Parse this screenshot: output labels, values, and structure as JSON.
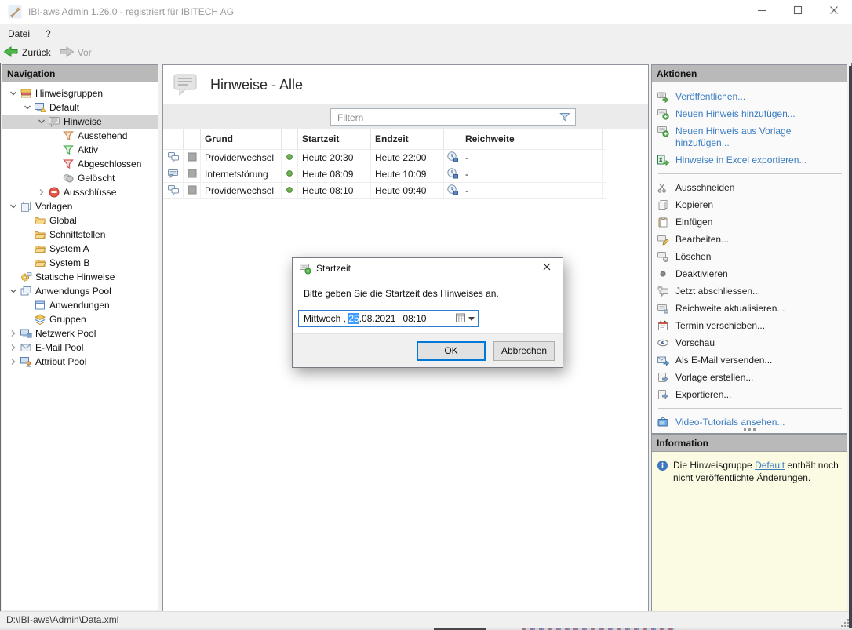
{
  "colors": {
    "link_blue": "#3a7cc0",
    "panel_header": "#b9b9b9",
    "selection": "#d4d4d4",
    "info_bg": "#fbfbe3",
    "focus_blue": "#2d7dd2",
    "highlight_blue": "#3d9bff",
    "filter_strip": "#ebebeb",
    "chrome": "#f0f0f0"
  },
  "window": {
    "title": "IBI-aws Admin 1.26.0 - registriert für IBITECH AG",
    "menu": [
      "Datei",
      "?"
    ],
    "toolbar": {
      "back": "Zurück",
      "forward": "Vor"
    },
    "status_path": "D:\\IBI-aws\\Admin\\Data.xml"
  },
  "navigation": {
    "header": "Navigation",
    "items": [
      {
        "label": "Hinweisgruppen",
        "icon": "layers",
        "expanded": true
      },
      {
        "label": "Default",
        "icon": "monitor-warn",
        "expanded": true
      },
      {
        "label": "Hinweise",
        "icon": "bubble",
        "expanded": true,
        "selected": true
      },
      {
        "label": "Ausstehend",
        "icon": "funnel-orange"
      },
      {
        "label": "Aktiv",
        "icon": "funnel-green"
      },
      {
        "label": "Abgeschlossen",
        "icon": "funnel-red"
      },
      {
        "label": "Gelöscht",
        "icon": "coins-gray"
      },
      {
        "label": "Ausschlüsse",
        "icon": "minus-red",
        "collapsed": true
      },
      {
        "label": "Vorlagen",
        "icon": "pages",
        "expanded": true
      },
      {
        "label": "Global",
        "icon": "folder"
      },
      {
        "label": "Schnittstellen",
        "icon": "folder"
      },
      {
        "label": "System A",
        "icon": "folder"
      },
      {
        "label": "System B",
        "icon": "folder"
      },
      {
        "label": "Statische Hinweise",
        "icon": "gear-bubble"
      },
      {
        "label": "Anwendungs Pool",
        "icon": "windows",
        "expanded": true
      },
      {
        "label": "Anwendungen",
        "icon": "window"
      },
      {
        "label": "Gruppen",
        "icon": "group-layers"
      },
      {
        "label": "Netzwerk Pool",
        "icon": "monitor-net",
        "collapsed": true
      },
      {
        "label": "E-Mail Pool",
        "icon": "mail",
        "collapsed": true
      },
      {
        "label": "Attribut Pool",
        "icon": "attribut",
        "collapsed": true
      }
    ]
  },
  "main": {
    "title": "Hinweise - Alle",
    "filter_placeholder": "Filtern",
    "table": {
      "columns": [
        "Grund",
        "Startzeit",
        "Endzeit",
        "Reichweite"
      ],
      "rows": [
        {
          "grund": "Providerwechsel",
          "startzeit": "Heute 20:30",
          "endzeit": "Heute 22:00",
          "reichweite": "-"
        },
        {
          "grund": "Internetstörung",
          "startzeit": "Heute 08:09",
          "endzeit": "Heute 10:09",
          "reichweite": "-"
        },
        {
          "grund": "Providerwechsel",
          "startzeit": "Heute 08:10",
          "endzeit": "Heute 09:40",
          "reichweite": "-"
        }
      ]
    }
  },
  "actions": {
    "header": "Aktionen",
    "items": [
      {
        "label": "Veröffentlichen...",
        "icon": "publish",
        "style": "link"
      },
      {
        "label": "Neuen Hinweis hinzufügen...",
        "icon": "bubble-plus",
        "style": "link"
      },
      {
        "label": "Neuen Hinweis aus Vorlage hinzufügen...",
        "icon": "bubble-plus",
        "style": "link"
      },
      {
        "label": "Hinweise in Excel exportieren...",
        "icon": "excel",
        "style": "link"
      },
      {
        "label": "Ausschneiden",
        "icon": "scissors",
        "style": "normal"
      },
      {
        "label": "Kopieren",
        "icon": "copy",
        "style": "normal"
      },
      {
        "label": "Einfügen",
        "icon": "paste",
        "style": "normal"
      },
      {
        "label": "Bearbeiten...",
        "icon": "edit",
        "style": "normal"
      },
      {
        "label": "Löschen",
        "icon": "delete",
        "style": "normal"
      },
      {
        "label": "Deaktivieren",
        "icon": "dot",
        "style": "normal"
      },
      {
        "label": "Jetzt abschliessen...",
        "icon": "check-bubble",
        "style": "normal"
      },
      {
        "label": "Reichweite aktualisieren...",
        "icon": "bubble-refresh",
        "style": "normal"
      },
      {
        "label": "Termin verschieben...",
        "icon": "calendar",
        "style": "normal"
      },
      {
        "label": "Vorschau",
        "icon": "eye",
        "style": "normal"
      },
      {
        "label": "Als E-Mail versenden...",
        "icon": "mail-send",
        "style": "normal"
      },
      {
        "label": "Vorlage erstellen...",
        "icon": "page-arrow",
        "style": "normal"
      },
      {
        "label": "Exportieren...",
        "icon": "page-arrow",
        "style": "normal"
      },
      {
        "label": "Video-Tutorials ansehen...",
        "icon": "tv",
        "style": "link"
      }
    ]
  },
  "information": {
    "header": "Information",
    "prefix": "Die Hinweisgruppe ",
    "link": "Default",
    "suffix": " enthält noch nicht veröffentlichte Änderungen."
  },
  "dialog": {
    "title": "Startzeit",
    "message": "Bitte geben Sie die Startzeit des Hinweises an.",
    "datetime": {
      "part1": "Mittwoch ,",
      "selected": "25",
      "part2": ".08.2021",
      "time": "08:10"
    },
    "ok_label": "OK",
    "cancel_label": "Abbrechen"
  }
}
